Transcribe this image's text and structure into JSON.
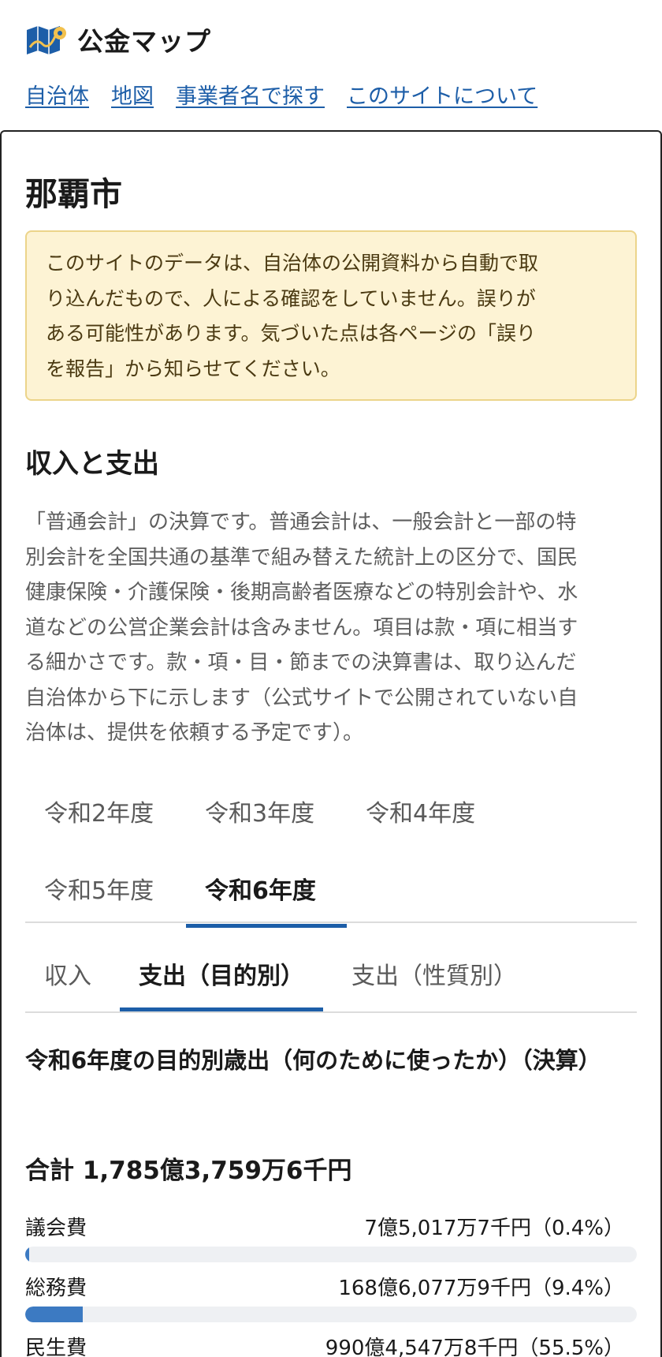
{
  "site": {
    "title": "公金マップ",
    "logo_icon": "map-pin-icon"
  },
  "nav": {
    "items": [
      "自治体",
      "地図",
      "事業者名で探す",
      "このサイトについて"
    ]
  },
  "page": {
    "title": "那覇市",
    "notice_line1": "このサイトのデータは、自治体の公開資料から自動で取",
    "notice_line2": "り込んだもので、人による確認をしていません。誤りが",
    "notice_line3": "ある可能性があります。気づいた点は各ページの「誤り",
    "notice_line4": "を報告」から知らせてください。"
  },
  "section": {
    "title": "収入と支出",
    "desc_line1": "「普通会計」の決算です。普通会計は、一般会計と一部の特",
    "desc_line2": "別会計を全国共通の基準で組み替えた統計上の区分で、国民",
    "desc_line3": "健康保険・介護保険・後期高齢者医療などの特別会計や、水",
    "desc_line4": "道などの公営企業会計は含みません。項目は款・項に相当す",
    "desc_line5": "る細かさです。款・項・目・節までの決算書は、取り込んだ",
    "desc_line6": "自治体から下に示します（公式サイトで公開されていない自",
    "desc_line7": "治体は、提供を依頼する予定です）。"
  },
  "year_tabs": [
    "令和2年度",
    "令和3年度",
    "令和4年度",
    "令和5年度",
    "令和6年度"
  ],
  "active_year": "令和6年度",
  "kind_tabs": [
    "収入",
    "支出（目的別）",
    "支出（性質別）"
  ],
  "active_kind": "支出（目的別）",
  "chart": {
    "title": "令和6年度の目的別歳出（何のために使ったか）（決算）",
    "total_label": "合計",
    "total_value": "1,785億3,759万6千円",
    "items": [
      {
        "name": "議会費",
        "amount": "7億5,017万7千円（0.4%）",
        "percent": 0.4
      },
      {
        "name": "総務費",
        "amount": "168億6,077万9千円（9.4%）",
        "percent": 9.4
      },
      {
        "name": "民生費",
        "amount": "990億4,547万8千円（55.5%）",
        "percent": 55.5
      }
    ]
  },
  "colors": {
    "accent": "#1d5ea8",
    "bar": "#3c7ac2",
    "notice_bg": "#fdf3d4",
    "notice_border": "#ecd48a"
  }
}
